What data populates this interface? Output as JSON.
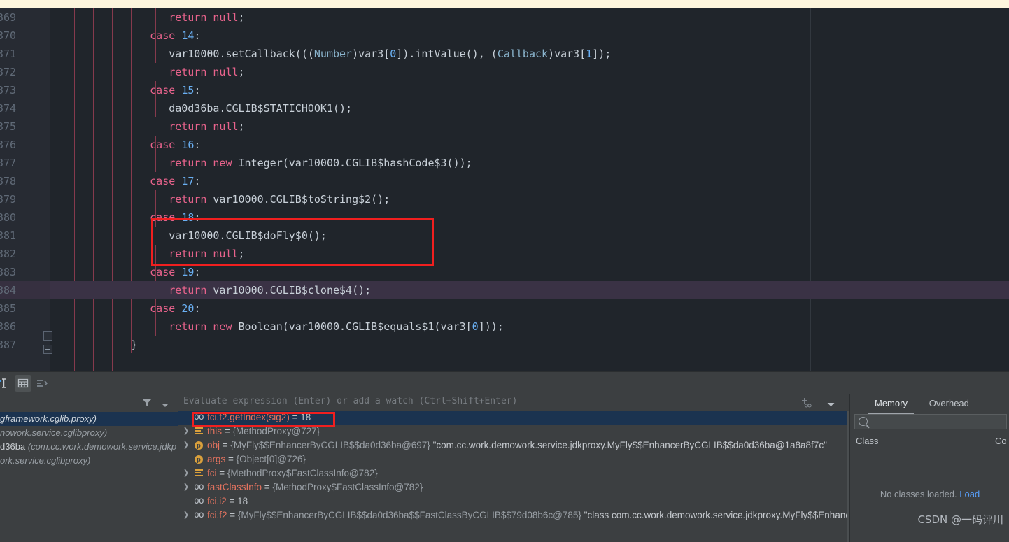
{
  "editor": {
    "first_line_number": 369,
    "highlighted_line_number": 384,
    "lines": [
      {
        "n": "369",
        "indent": 5,
        "tokens": [
          {
            "t": "return",
            "c": "kw2"
          },
          {
            "t": " null",
            "c": "nullv"
          },
          {
            "t": ";",
            "c": "punc"
          }
        ]
      },
      {
        "n": "370",
        "indent": 4,
        "tokens": [
          {
            "t": "case",
            "c": "kw2"
          },
          {
            "t": " ",
            "c": "punc"
          },
          {
            "t": "14",
            "c": "num"
          },
          {
            "t": ":",
            "c": "punc"
          }
        ]
      },
      {
        "n": "371",
        "indent": 5,
        "tokens": [
          {
            "t": "var10000",
            "c": "id"
          },
          {
            "t": ".setCallback(((",
            "c": "punc"
          },
          {
            "t": "Number",
            "c": "cls"
          },
          {
            "t": ")var3[",
            "c": "punc"
          },
          {
            "t": "0",
            "c": "num"
          },
          {
            "t": "]).intValue(), (",
            "c": "punc"
          },
          {
            "t": "Callback",
            "c": "cls"
          },
          {
            "t": ")var3[",
            "c": "punc"
          },
          {
            "t": "1",
            "c": "num"
          },
          {
            "t": "]);",
            "c": "punc"
          }
        ]
      },
      {
        "n": "372",
        "indent": 5,
        "tokens": [
          {
            "t": "return",
            "c": "kw2"
          },
          {
            "t": " null",
            "c": "nullv"
          },
          {
            "t": ";",
            "c": "punc"
          }
        ]
      },
      {
        "n": "373",
        "indent": 4,
        "tokens": [
          {
            "t": "case",
            "c": "kw2"
          },
          {
            "t": " ",
            "c": "punc"
          },
          {
            "t": "15",
            "c": "num"
          },
          {
            "t": ":",
            "c": "punc"
          }
        ]
      },
      {
        "n": "374",
        "indent": 5,
        "tokens": [
          {
            "t": "da0d36ba.CGLIB$STATICHOOK1();",
            "c": "id"
          }
        ]
      },
      {
        "n": "375",
        "indent": 5,
        "tokens": [
          {
            "t": "return",
            "c": "kw2"
          },
          {
            "t": " null",
            "c": "nullv"
          },
          {
            "t": ";",
            "c": "punc"
          }
        ]
      },
      {
        "n": "376",
        "indent": 4,
        "tokens": [
          {
            "t": "case",
            "c": "kw2"
          },
          {
            "t": " ",
            "c": "punc"
          },
          {
            "t": "16",
            "c": "num"
          },
          {
            "t": ":",
            "c": "punc"
          }
        ]
      },
      {
        "n": "377",
        "indent": 5,
        "tokens": [
          {
            "t": "return",
            "c": "kw2"
          },
          {
            "t": " ",
            "c": "punc"
          },
          {
            "t": "new",
            "c": "kw2"
          },
          {
            "t": " Integer(var10000.CGLIB$hashCode$3());",
            "c": "id"
          }
        ]
      },
      {
        "n": "378",
        "indent": 4,
        "tokens": [
          {
            "t": "case",
            "c": "kw2"
          },
          {
            "t": " ",
            "c": "punc"
          },
          {
            "t": "17",
            "c": "num"
          },
          {
            "t": ":",
            "c": "punc"
          }
        ]
      },
      {
        "n": "379",
        "indent": 5,
        "tokens": [
          {
            "t": "return",
            "c": "kw2"
          },
          {
            "t": " var10000.CGLIB$toString$2();",
            "c": "id"
          }
        ]
      },
      {
        "n": "380",
        "indent": 4,
        "tokens": [
          {
            "t": "case",
            "c": "kw2"
          },
          {
            "t": " ",
            "c": "punc"
          },
          {
            "t": "18",
            "c": "num"
          },
          {
            "t": ":",
            "c": "punc"
          }
        ]
      },
      {
        "n": "381",
        "indent": 5,
        "tokens": [
          {
            "t": "var10000.CGLIB$doFly$0();",
            "c": "id"
          }
        ]
      },
      {
        "n": "382",
        "indent": 5,
        "tokens": [
          {
            "t": "return",
            "c": "kw2"
          },
          {
            "t": " null",
            "c": "nullv"
          },
          {
            "t": ";",
            "c": "punc"
          }
        ]
      },
      {
        "n": "383",
        "indent": 4,
        "tokens": [
          {
            "t": "case",
            "c": "kw2"
          },
          {
            "t": " ",
            "c": "punc"
          },
          {
            "t": "19",
            "c": "num"
          },
          {
            "t": ":",
            "c": "punc"
          }
        ]
      },
      {
        "n": "384",
        "indent": 5,
        "tokens": [
          {
            "t": "return",
            "c": "kw2"
          },
          {
            "t": " var10000.CGLIB$clone$4();",
            "c": "id"
          }
        ]
      },
      {
        "n": "385",
        "indent": 4,
        "tokens": [
          {
            "t": "case",
            "c": "kw2"
          },
          {
            "t": " ",
            "c": "punc"
          },
          {
            "t": "20",
            "c": "num"
          },
          {
            "t": ":",
            "c": "punc"
          }
        ]
      },
      {
        "n": "386",
        "indent": 5,
        "tokens": [
          {
            "t": "return",
            "c": "kw2"
          },
          {
            "t": " ",
            "c": "punc"
          },
          {
            "t": "new",
            "c": "kw2"
          },
          {
            "t": " Boolean(var10000.CGLIB$equals$1(var3[",
            "c": "id"
          },
          {
            "t": "0",
            "c": "num"
          },
          {
            "t": "]));",
            "c": "punc"
          }
        ]
      },
      {
        "n": "387",
        "indent": 3,
        "tokens": [
          {
            "t": "}",
            "c": "punc"
          }
        ]
      }
    ],
    "annotation_label": "red-highlight-case-18"
  },
  "debug_toolbar": {
    "buttons": [
      {
        "name": "text-cursor-icon"
      },
      {
        "name": "table-view-icon"
      },
      {
        "name": "group-by-icon"
      }
    ]
  },
  "frames": {
    "filter_icon": "filter-icon",
    "dropdown_icon": "chevron-down-icon",
    "rows": [
      {
        "prefix": "",
        "text": "gframework.cglib.proxy)",
        "selected": true
      },
      {
        "prefix": "",
        "text": "nowork.service.cglibproxy)",
        "selected": false
      },
      {
        "prefix": "d36ba",
        "text": " (com.cc.work.demowork.service.jdkp",
        "selected": false
      },
      {
        "prefix": "",
        "text": "ork.service.cglibproxy)",
        "selected": false
      }
    ]
  },
  "evaluate": {
    "placeholder": "Evaluate expression (Enter) or add a watch (Ctrl+Shift+Enter)",
    "add_watch_icon": "add-watch-icon",
    "dropdown_icon": "chevron-down-icon"
  },
  "variables": [
    {
      "icon": "watch",
      "expandable": false,
      "name": "fci.f2.getIndex(sig2)",
      "eq": " = ",
      "value": "18",
      "string": "",
      "selected": true,
      "highlighted": true
    },
    {
      "icon": "object",
      "expandable": true,
      "name": "this",
      "eq": " = ",
      "value": "{MethodProxy@727}",
      "string": "",
      "selected": false,
      "highlighted": false
    },
    {
      "icon": "param",
      "expandable": true,
      "name": "obj",
      "eq": " = ",
      "value": "{MyFly$$EnhancerByCGLIB$$da0d36ba@697}",
      "string": "\"com.cc.work.demowork.service.jdkproxy.MyFly$$EnhancerByCGLIB$$da0d36ba@1a8a8f7c\"",
      "selected": false,
      "highlighted": false
    },
    {
      "icon": "param",
      "expandable": false,
      "name": "args",
      "eq": " = ",
      "value": "{Object[0]@726}",
      "string": "",
      "selected": false,
      "highlighted": false
    },
    {
      "icon": "object",
      "expandable": true,
      "name": "fci",
      "eq": " = ",
      "value": "{MethodProxy$FastClassInfo@782}",
      "string": "",
      "selected": false,
      "highlighted": false
    },
    {
      "icon": "watch",
      "expandable": true,
      "name": "fastClassInfo",
      "eq": " = ",
      "value": "{MethodProxy$FastClassInfo@782}",
      "string": "",
      "selected": false,
      "highlighted": false
    },
    {
      "icon": "watch",
      "expandable": false,
      "name": "fci.i2",
      "eq": " = ",
      "value": "18",
      "string": "",
      "selected": false,
      "highlighted": false
    },
    {
      "icon": "watch",
      "expandable": true,
      "name": "fci.f2",
      "eq": " = ",
      "value": "{MyFly$$EnhancerByCGLIB$$da0d36ba$$FastClassByCGLIB$$79d08b6c@785}",
      "string": "\"class com.cc.work.demowork.service.jdkproxy.MyFly$$EnhancerByCGLI",
      "selected": false,
      "highlighted": false
    }
  ],
  "memory": {
    "tabs": [
      {
        "label": "Memory",
        "active": true
      },
      {
        "label": "Overhead",
        "active": false
      }
    ],
    "search_icon": "search-icon",
    "search_value": "",
    "columns": [
      "Class",
      "Co"
    ],
    "empty_text": "No classes loaded. ",
    "empty_link": "Load"
  },
  "watermark": "CSDN @一码评川",
  "colors": {
    "editor_bg": "#20252b",
    "gutter_bg": "#272b33",
    "panel_bg": "#3c3f41",
    "selection_blue": "#1b3350",
    "annotation_red": "#f01f1f",
    "accent_link": "#589df6",
    "top_strip": "#fdf6dd"
  }
}
